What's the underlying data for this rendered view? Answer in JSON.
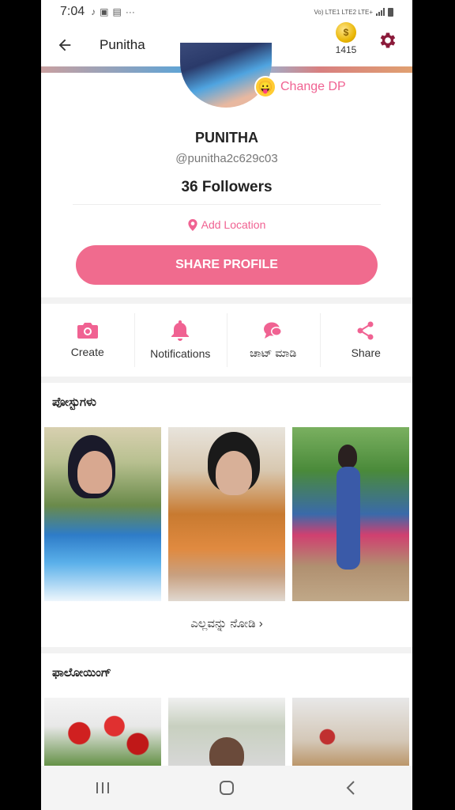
{
  "status_bar": {
    "time": "7:04",
    "indicators": [
      "tiktok-icon",
      "screen-record-icon",
      "gallery-icon",
      "more-dots"
    ],
    "right_text": "Vo) LTE1 LTE2 LTE+"
  },
  "top_bar": {
    "title": "Punitha",
    "coin_count": "1415"
  },
  "profile": {
    "change_dp_label": "Change DP",
    "name": "PUNITHA",
    "handle": "@punitha2c629c03",
    "followers": "36 Followers",
    "add_location": "Add Location",
    "share_button": "SHARE PROFILE"
  },
  "actions": [
    {
      "label": "Create",
      "icon": "camera-icon"
    },
    {
      "label": "Notifications",
      "icon": "bell-icon"
    },
    {
      "label": "ಚಾಟ್ ಮಾಡಿ",
      "icon": "chat-icon"
    },
    {
      "label": "Share",
      "icon": "share-icon"
    }
  ],
  "posts": {
    "title": "ಪೋಸ್ಟುಗಳು",
    "see_all": "ಎಲ್ಲವನ್ನು ನೋಡಿ ›"
  },
  "following": {
    "title": "ಫಾಲೋಯಿಂಗ್"
  },
  "colors": {
    "accent": "#f06b8e",
    "accent_text": "#f06292"
  }
}
